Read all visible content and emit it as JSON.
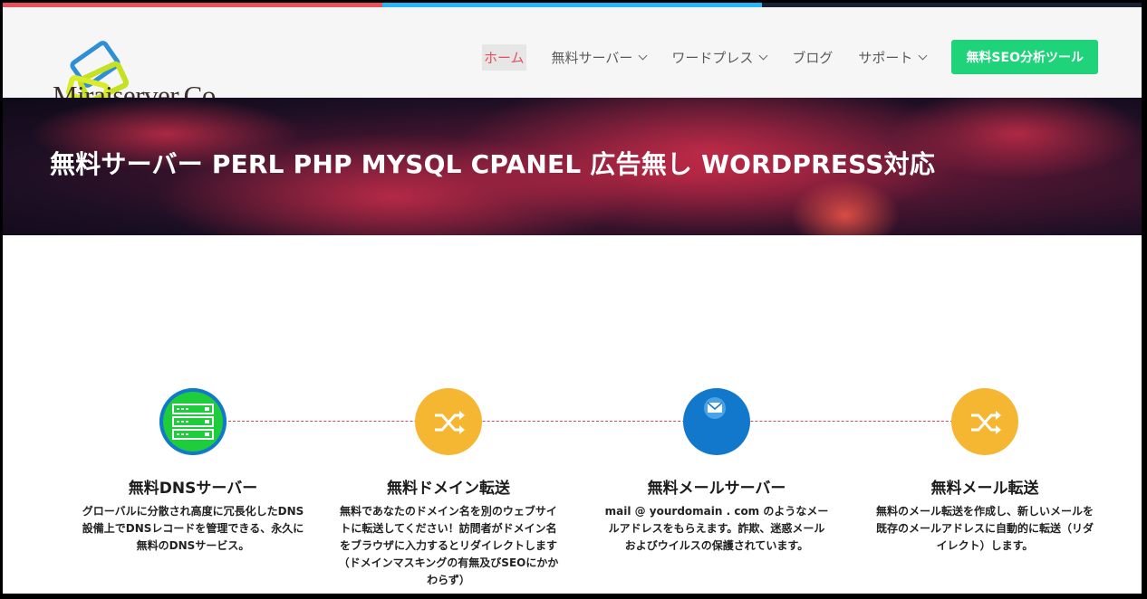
{
  "brand": {
    "logo_text": "Miraiserver.Co",
    "accent_colors": [
      "#e8505b",
      "#29b6f6",
      "#1a1f33"
    ]
  },
  "nav": {
    "items": [
      {
        "label": "ホーム",
        "active": true,
        "dropdown": false
      },
      {
        "label": "無料サーバー",
        "active": false,
        "dropdown": true
      },
      {
        "label": "ワードプレス",
        "active": false,
        "dropdown": true
      },
      {
        "label": "ブログ",
        "active": false,
        "dropdown": false
      },
      {
        "label": "サポート",
        "active": false,
        "dropdown": true
      }
    ],
    "cta_label": "無料SEO分析ツール",
    "cta_color": "#1ed37a"
  },
  "hero": {
    "title": "無料サーバー PERL PHP MYSQL CPANEL 広告無し WORDPRESS対応"
  },
  "features": [
    {
      "title": "無料DNSサーバー",
      "description": "グローバルに分散され高度に冗長化したDNS設備上でDNSレコードを管理できる、永久に無料のDNSサービス。",
      "icon": "server-icon",
      "color": "#1fcc3c"
    },
    {
      "title": "無料ドメイン転送",
      "description": "無料であなたのドメイン名を別のウェブサイトに転送してください！訪問者がドメイン名をブラウザに入力するとリダイレクトします（ドメインマスキングの有無及びSEOにかかわらず）",
      "icon": "shuffle-icon",
      "color": "#f5b731"
    },
    {
      "title": "無料メールサーバー",
      "description": "mail @ yourdomain . com のようなメールアドレスをもらえます。詐欺、迷惑メールおよびウイルスの保護されています。",
      "icon": "envelope-icon",
      "color": "#1278cc"
    },
    {
      "title": "無料メール転送",
      "description": "無料のメール転送を作成し、新しいメールを既存のメールアドレスに自動的に転送（リダイレクト）します。",
      "icon": "shuffle-icon",
      "color": "#f5b731"
    }
  ]
}
